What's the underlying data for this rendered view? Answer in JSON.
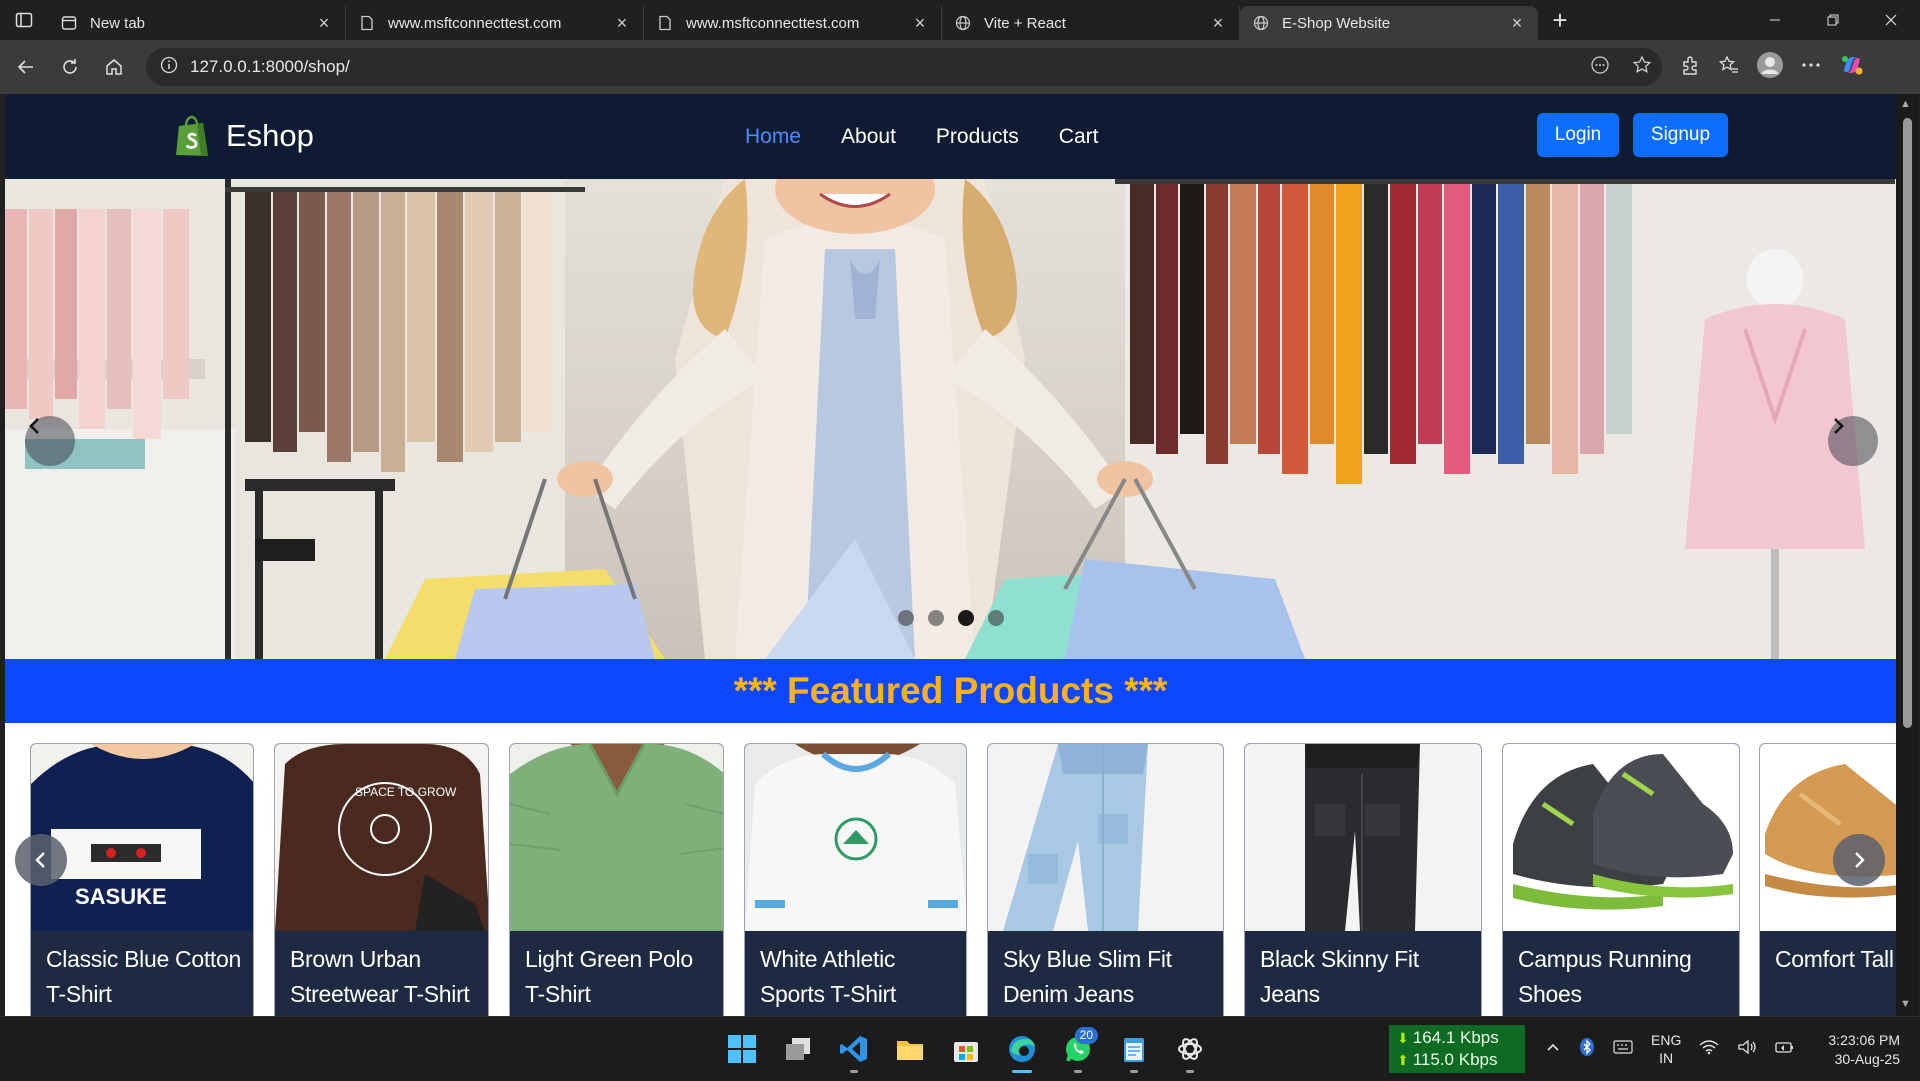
{
  "browser": {
    "tabs": [
      {
        "title": "New tab",
        "icon": "newtab-icon"
      },
      {
        "title": "www.msftconnecttest.com",
        "icon": "page-icon"
      },
      {
        "title": "www.msftconnecttest.com",
        "icon": "page-icon"
      },
      {
        "title": "Vite + React",
        "icon": "globe-icon"
      },
      {
        "title": "E-Shop Website",
        "icon": "globe-icon",
        "active": true
      }
    ],
    "address": "127.0.0.1:8000/shop/"
  },
  "site": {
    "brand": "Eshop",
    "nav": {
      "home": "Home",
      "about": "About",
      "products": "Products",
      "cart": "Cart"
    },
    "auth": {
      "login": "Login",
      "signup": "Signup"
    },
    "carousel": {
      "slides": 4,
      "active_slide": 3
    },
    "featured_title": "*** Featured Products ***",
    "products": [
      {
        "name": "Classic Blue Cotton T-Shirt"
      },
      {
        "name": "Brown Urban Streetwear T-Shirt"
      },
      {
        "name": "Light Green Polo T-Shirt"
      },
      {
        "name": "White Athletic Sports T-Shirt"
      },
      {
        "name": "Sky Blue Slim Fit Denim Jeans"
      },
      {
        "name": "Black Skinny Fit Jeans"
      },
      {
        "name": "Campus Running Shoes"
      },
      {
        "name": "Comfort Tall Loafers"
      }
    ],
    "print_text": {
      "sasuke": "SASUKE",
      "brown_shirt": "SPACE TO GROW"
    }
  },
  "taskbar": {
    "whatsapp_badge": "20",
    "download_speed": "164.1 Kbps",
    "upload_speed": "115.0 Kbps",
    "lang_top": "ENG",
    "lang_bottom": "IN",
    "time": "3:23:06 PM",
    "date": "30-Aug-25"
  },
  "colors": {
    "navbar": "#0f1b32",
    "accent_blue": "#0d6efd",
    "featured_bg": "#0d47ff",
    "featured_text": "#ffb01f",
    "card_bg": "#1d2a42"
  }
}
